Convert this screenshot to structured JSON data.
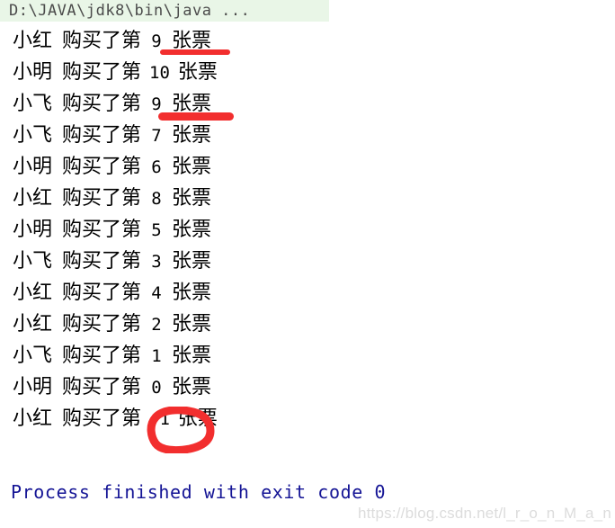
{
  "console": {
    "command_line": "D:\\JAVA\\jdk8\\bin\\java ...",
    "command_highlight_color": "#e9f6e7",
    "command_text_color": "#4b4b4b",
    "exit_message": "Process finished with exit code 0",
    "exit_message_color": "#141495"
  },
  "output": {
    "lines": [
      {
        "buyer": "小红",
        "phrase": "购买了第",
        "number": "9",
        "suffix": "张票"
      },
      {
        "buyer": "小明",
        "phrase": "购买了第",
        "number": "10",
        "suffix": "张票"
      },
      {
        "buyer": "小飞",
        "phrase": "购买了第",
        "number": "9",
        "suffix": "张票"
      },
      {
        "buyer": "小飞",
        "phrase": "购买了第",
        "number": "7",
        "suffix": "张票"
      },
      {
        "buyer": "小明",
        "phrase": "购买了第",
        "number": "6",
        "suffix": "张票"
      },
      {
        "buyer": "小红",
        "phrase": "购买了第",
        "number": "8",
        "suffix": "张票"
      },
      {
        "buyer": "小明",
        "phrase": "购买了第",
        "number": "5",
        "suffix": "张票"
      },
      {
        "buyer": "小飞",
        "phrase": "购买了第",
        "number": "3",
        "suffix": "张票"
      },
      {
        "buyer": "小红",
        "phrase": "购买了第",
        "number": "4",
        "suffix": "张票"
      },
      {
        "buyer": "小红",
        "phrase": "购买了第",
        "number": "2",
        "suffix": "张票"
      },
      {
        "buyer": "小飞",
        "phrase": "购买了第",
        "number": "1",
        "suffix": "张票"
      },
      {
        "buyer": "小明",
        "phrase": "购买了第",
        "number": "0",
        "suffix": "张票"
      },
      {
        "buyer": "小红",
        "phrase": "购买了第",
        "number": "-1",
        "suffix": "张票"
      }
    ]
  },
  "annotations": {
    "color": "#f22e2e",
    "underline_1_target": "9",
    "underline_2_target": "9",
    "circle_1_target": "-1"
  },
  "watermark": {
    "text": "https://blog.csdn.net/l_r_o_n_M_a_n",
    "color": "#dcdcdc"
  }
}
